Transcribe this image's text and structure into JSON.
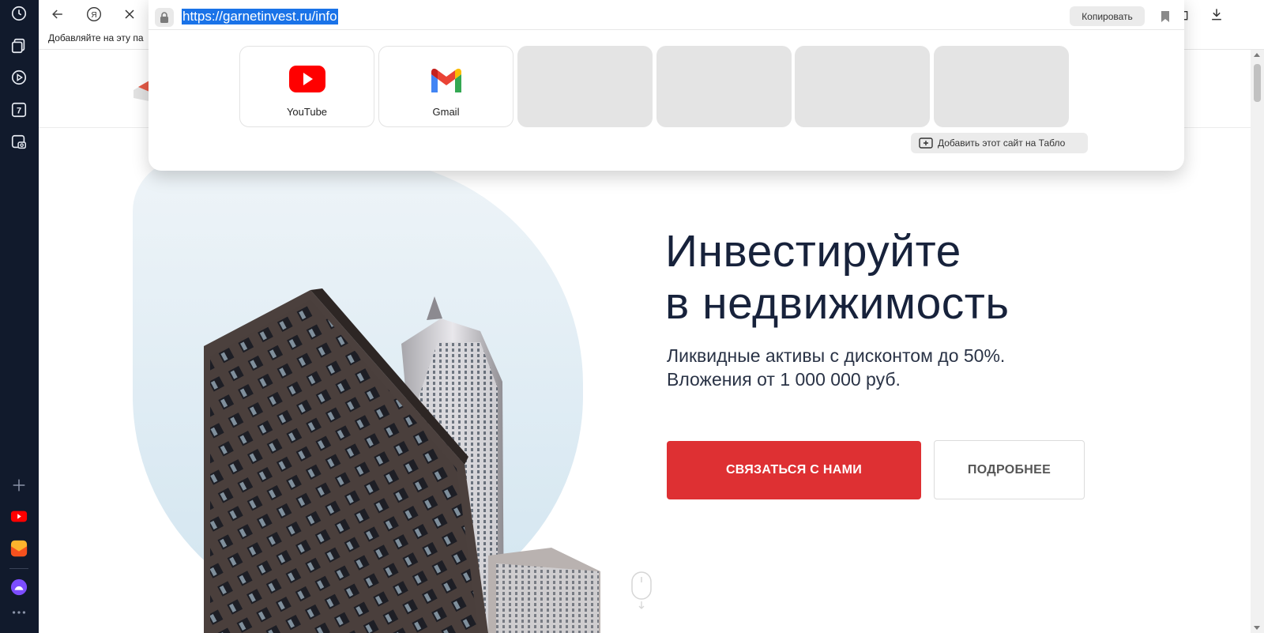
{
  "browser": {
    "url": "https://garnetinvest.ru/info",
    "copy_label": "Копировать",
    "bookmarks_bar_text": "Добавляйте на эту па",
    "add_to_tablo_label": "Добавить этот сайт на Табло",
    "tiles": [
      {
        "label": "YouTube",
        "icon": "youtube-icon"
      },
      {
        "label": "Gmail",
        "icon": "gmail-icon"
      },
      {
        "label": ""
      },
      {
        "label": ""
      },
      {
        "label": ""
      },
      {
        "label": ""
      }
    ],
    "sidebar_badge": "7"
  },
  "page": {
    "hero_title_line1": "Инвестируйте",
    "hero_title_line2": "в недвижимость",
    "hero_sub_line1": "Ликвидные активы с дисконтом до 50%.",
    "hero_sub_line2": "Вложения от 1 000 000 руб.",
    "primary_button": "СВЯЗАТЬСЯ С НАМИ",
    "secondary_button": "ПОДРОБНЕЕ"
  },
  "colors": {
    "accent": "#de3033",
    "sidebar": "#111a2c",
    "selection": "#1a73e8"
  }
}
